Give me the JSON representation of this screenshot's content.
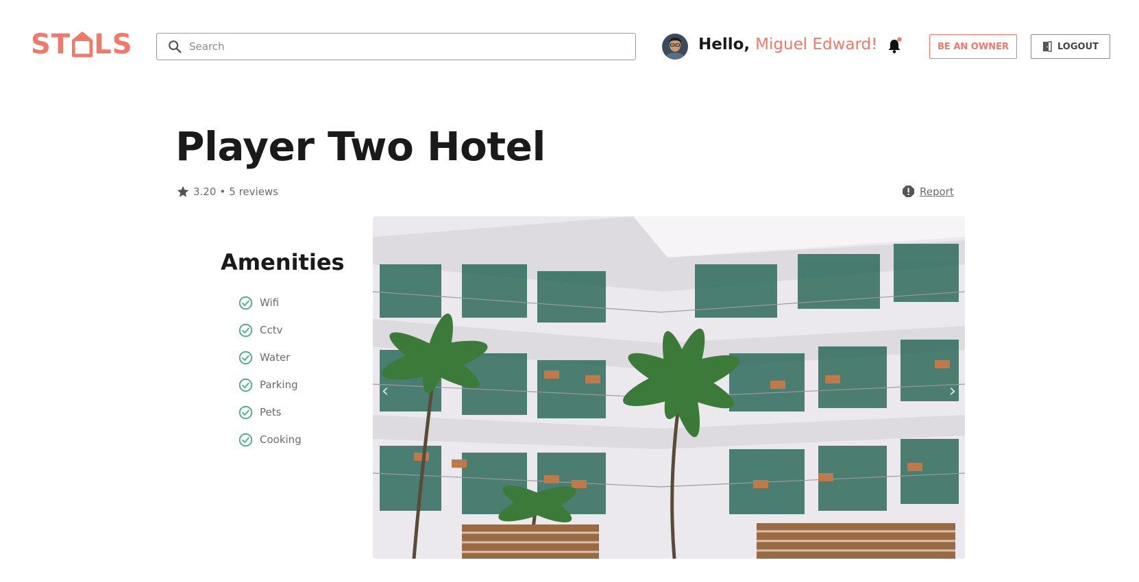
{
  "header": {
    "logo_text_start": "ST",
    "logo_text_end": "LS",
    "search_placeholder": "Search",
    "greeting_hello": "Hello,",
    "greeting_user": "Miguel Edward!",
    "be_owner_label": "BE AN OWNER",
    "logout_label": "LOGOUT"
  },
  "listing": {
    "title": "Player Two Hotel",
    "rating": "3.20",
    "separator": "•",
    "reviews": "5 reviews",
    "report_label": "Report"
  },
  "amenities": {
    "title": "Amenities",
    "items": [
      "Wifi",
      "Cctv",
      "Water",
      "Parking",
      "Pets",
      "Cooking"
    ]
  },
  "carousel": {
    "prev_icon": "chevron-left-icon",
    "next_icon": "chevron-right-icon"
  },
  "colors": {
    "brand": "#f2786a",
    "check": "#4caf8a",
    "muted": "#6b6b6b"
  }
}
